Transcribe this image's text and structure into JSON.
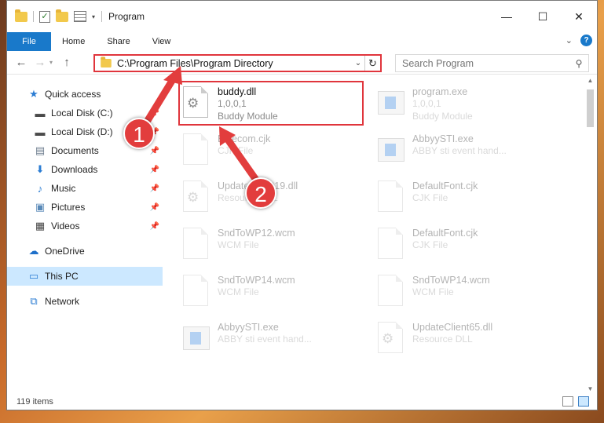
{
  "window": {
    "title": "Program"
  },
  "window_controls": {
    "minimize": "—",
    "maximize": "☐",
    "close": "✕"
  },
  "ribbon": {
    "tabs": [
      "File",
      "Home",
      "Share",
      "View"
    ],
    "help": "?"
  },
  "address": {
    "path": "C:\\Program Files\\Program Directory"
  },
  "search": {
    "placeholder": "Search Program"
  },
  "sidebar": {
    "items": [
      {
        "label": "Quick access",
        "icon": "star-icon",
        "pinned": false
      },
      {
        "label": "Local Disk (C:)",
        "icon": "drive-icon",
        "pinned": true
      },
      {
        "label": "Local Disk (D:)",
        "icon": "drive-icon",
        "pinned": true
      },
      {
        "label": "Documents",
        "icon": "document-icon",
        "pinned": true
      },
      {
        "label": "Downloads",
        "icon": "download-icon",
        "pinned": true
      },
      {
        "label": "Music",
        "icon": "music-icon",
        "pinned": true
      },
      {
        "label": "Pictures",
        "icon": "pictures-icon",
        "pinned": true
      },
      {
        "label": "Videos",
        "icon": "videos-icon",
        "pinned": true
      },
      {
        "label": "OneDrive",
        "icon": "cloud-icon",
        "pinned": false
      },
      {
        "label": "This PC",
        "icon": "computer-icon",
        "pinned": false,
        "selected": true
      },
      {
        "label": "Network",
        "icon": "network-icon",
        "pinned": false
      }
    ]
  },
  "files": [
    {
      "name": "buddy.dll",
      "line1": "1,0,0,1",
      "line2": "Buddy Module",
      "icon": "gear-document-icon",
      "highlighted": true
    },
    {
      "name": "program.exe",
      "line1": "1,0,0,1",
      "line2": "Buddy Module",
      "icon": "executable-icon"
    },
    {
      "name": "Bluecom.cjk",
      "line1": "CJK File",
      "line2": "",
      "icon": "document-icon"
    },
    {
      "name": "AbbyySTI.exe",
      "line1": "ABBY sti event hand...",
      "line2": "",
      "icon": "executable-icon"
    },
    {
      "name": "UpdateClient19.dll",
      "line1": "Resource DLL",
      "line2": "",
      "icon": "gear-document-icon"
    },
    {
      "name": "DefaultFont.cjk",
      "line1": "CJK File",
      "line2": "",
      "icon": "document-icon"
    },
    {
      "name": "SndToWP12.wcm",
      "line1": "WCM File",
      "line2": "",
      "icon": "document-icon"
    },
    {
      "name": "DefaultFont.cjk",
      "line1": "CJK File",
      "line2": "",
      "icon": "document-icon"
    },
    {
      "name": "SndToWP14.wcm",
      "line1": "WCM File",
      "line2": "",
      "icon": "document-icon"
    },
    {
      "name": "SndToWP14.wcm",
      "line1": "WCM File",
      "line2": "",
      "icon": "document-icon"
    },
    {
      "name": "AbbyySTI.exe",
      "line1": "ABBY sti event hand...",
      "line2": "",
      "icon": "executable-icon"
    },
    {
      "name": "UpdateClient65.dll",
      "line1": "Resource DLL",
      "line2": "",
      "icon": "gear-document-icon"
    }
  ],
  "status": {
    "item_count": "119 items"
  },
  "callouts": {
    "step1": "1",
    "step2": "2"
  },
  "colors": {
    "accent": "#1979ca",
    "highlight": "#e0353c",
    "selection": "#cce8ff",
    "callout": "#e23d3d"
  }
}
